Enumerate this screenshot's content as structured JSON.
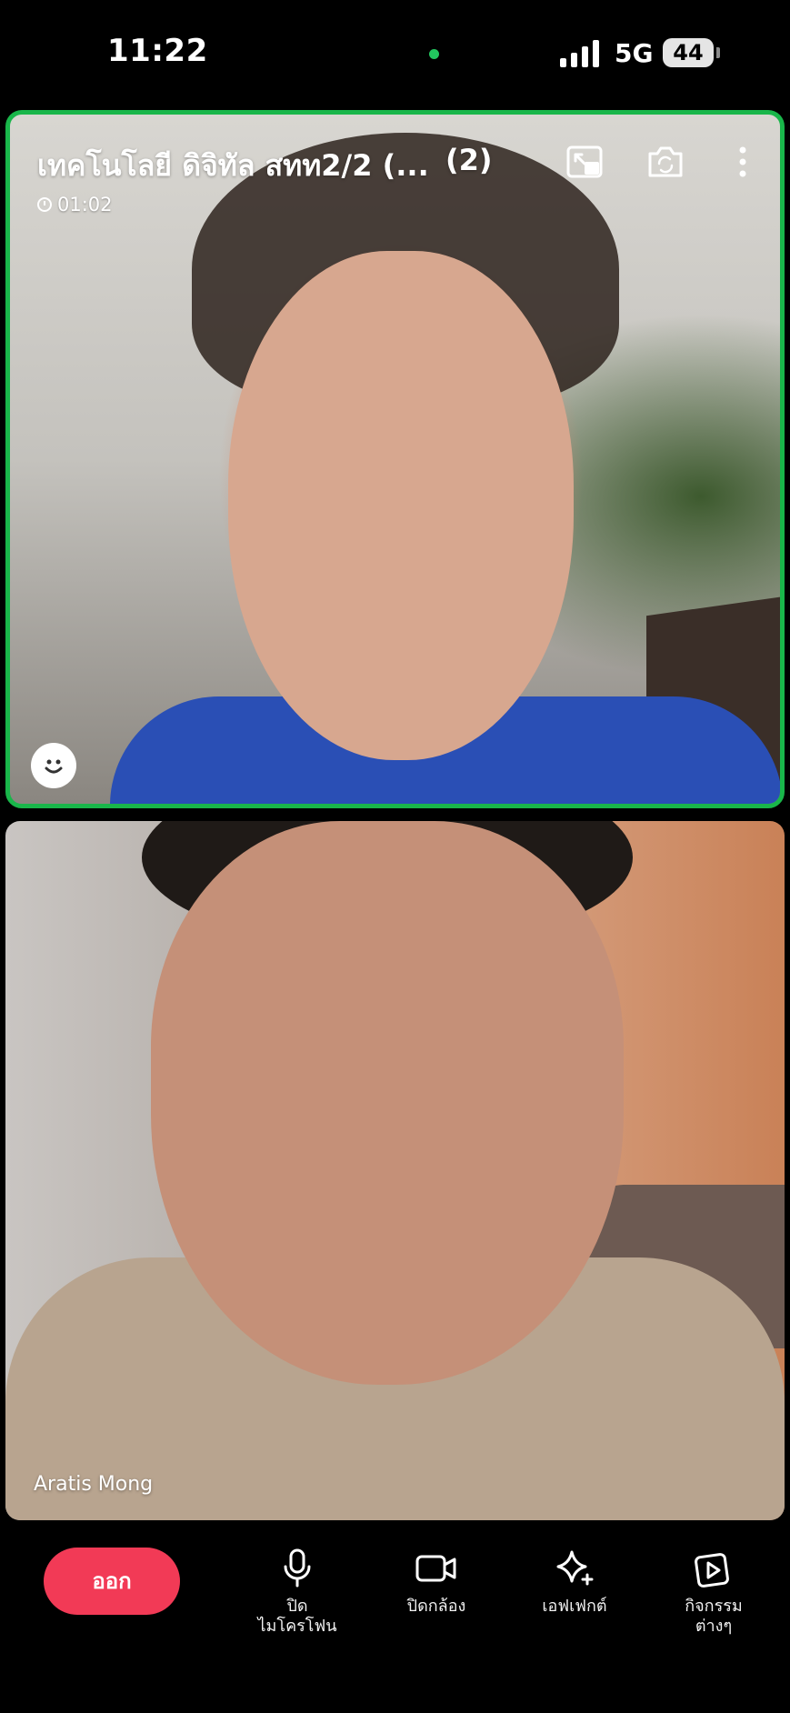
{
  "status_bar": {
    "time": "11:22",
    "network": "5G",
    "battery": "44"
  },
  "call": {
    "title": "เทคโนโลยี ดิจิทัล สทท2/2 (...",
    "participant_count": "(2)",
    "duration": "01:02"
  },
  "participants": [
    {
      "name": ""
    },
    {
      "name": "Aratis Mong"
    }
  ],
  "controls": {
    "leave_label": "ออก",
    "mic_label_line1": "ปิด",
    "mic_label_line2": "ไมโครโฟน",
    "camera_label": "ปิดกล้อง",
    "effects_label": "เอฟเฟกต์",
    "activities_label_line1": "กิจกรรม",
    "activities_label_line2": "ต่างๆ"
  },
  "icons": {
    "pip": "pip-icon",
    "flip_camera": "flip-camera-icon",
    "more": "more-vertical-icon",
    "emoji": "smile-icon",
    "mic": "microphone-icon",
    "camera": "video-camera-icon",
    "effects": "sparkles-icon",
    "activities": "play-square-icon"
  },
  "colors": {
    "active_speaker_border": "#19b64a",
    "leave_button": "#f23a56",
    "camera_indicator": "#22c55e"
  }
}
